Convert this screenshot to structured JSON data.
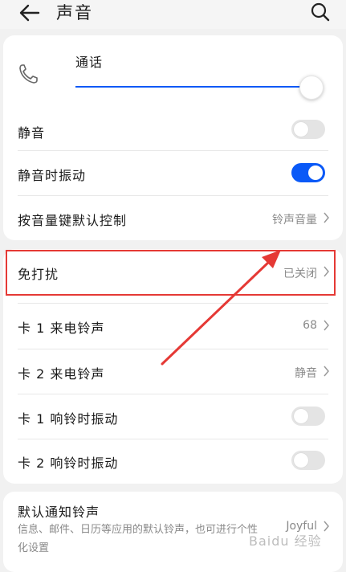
{
  "header": {
    "title": "声音",
    "back_icon": "back-arrow-icon",
    "search_icon": "search-icon"
  },
  "call_volume": {
    "label": "通话",
    "level": 1.0,
    "accent": "#0a59f7"
  },
  "rows": {
    "mute": {
      "label": "静音",
      "toggle_on": false
    },
    "mute_vibrate": {
      "label": "静音时振动",
      "toggle_on": true
    },
    "volume_key": {
      "label": "按音量键默认控制",
      "value": "铃声音量"
    },
    "dnd": {
      "label": "免打扰",
      "value": "已关闭"
    },
    "sim1_ringtone": {
      "label": "卡 1 来电铃声",
      "value": "68"
    },
    "sim2_ringtone": {
      "label": "卡 2 来电铃声",
      "value": "静音"
    },
    "sim1_vibrate": {
      "label": "卡 1 响铃时振动",
      "toggle_on": false
    },
    "sim2_vibrate": {
      "label": "卡 2 响铃时振动",
      "toggle_on": false
    },
    "notification_tone": {
      "label": "默认通知铃声",
      "description": "信息、邮件、日历等应用的默认铃声，也可进行个性化设置",
      "value": "Joyful"
    }
  },
  "annotation": {
    "color": "#e53935"
  },
  "watermark": "Baidu 经验"
}
